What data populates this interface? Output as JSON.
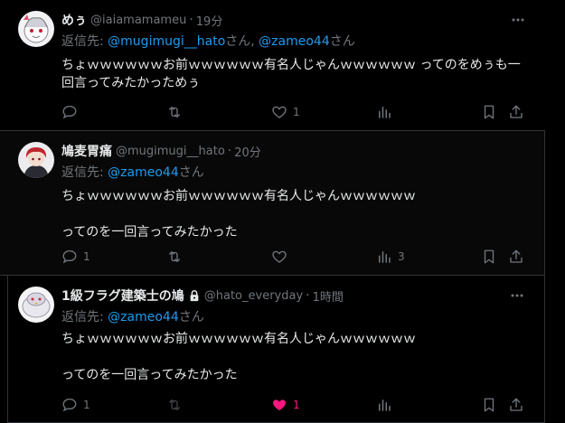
{
  "tweets": [
    {
      "name": "めぅ",
      "handle": "@iaiamamameu",
      "time": "19分",
      "reply_prefix": "返信先: ",
      "mentions": [
        "@mugimugi__hato",
        "@zameo44"
      ],
      "mention_suffix": "さん",
      "mention_sep": ", ",
      "text": "ちょｗｗｗｗｗｗお前ｗｗｗｗｗｗ有名人じゃんｗｗｗｗｗｗ ってのをめぅも一回言ってみたかっためぅ",
      "reply_count": "",
      "retweet_count": "",
      "like_count": "1",
      "view_count": "",
      "liked": false
    },
    {
      "name": "鳩麦胃痛",
      "handle": "@mugimugi__hato",
      "time": "20分",
      "reply_prefix": "返信先: ",
      "mentions": [
        "@zameo44"
      ],
      "mention_suffix": "さん",
      "mention_sep": "",
      "text": "ちょｗｗｗｗｗｗお前ｗｗｗｗｗｗ有名人じゃんｗｗｗｗｗｗ\n\nってのを一回言ってみたかった",
      "reply_count": "1",
      "retweet_count": "",
      "like_count": "",
      "view_count": "3",
      "liked": false
    },
    {
      "name": "1級フラグ建築士の鳩",
      "handle": "@hato_everyday",
      "time": "1時間",
      "reply_prefix": "返信先: ",
      "mentions": [
        "@zameo44"
      ],
      "mention_suffix": "さん",
      "mention_sep": "",
      "text": "ちょｗｗｗｗｗｗお前ｗｗｗｗｗｗ有名人じゃんｗｗｗｗｗｗ\n\nってのを一回言ってみたかった",
      "reply_count": "1",
      "retweet_count": "",
      "like_count": "1",
      "view_count": "",
      "liked": true,
      "protected": true
    }
  ],
  "separator": "·",
  "colors": {
    "background": "#000000",
    "text": "#e7e9ea",
    "muted": "#71767b",
    "link": "#1d9bf0",
    "like": "#f91880",
    "border": "#2f3336"
  },
  "icons": [
    "reply-icon",
    "retweet-icon",
    "like-icon",
    "views-icon",
    "bookmark-icon",
    "share-icon",
    "more-icon",
    "lock-icon"
  ]
}
